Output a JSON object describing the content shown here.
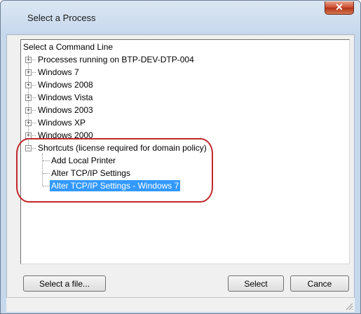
{
  "window": {
    "title": "Select a Process",
    "close_glyph": "✕"
  },
  "tree": {
    "header": "Select a Command Line",
    "expand_glyph": "+",
    "collapse_glyph": "−",
    "nodes": [
      "Processes running on BTP-DEV-DTP-004",
      "Windows 7",
      "Windows 2008",
      "Windows Vista",
      "Windows 2003",
      "Windows XP",
      "Windows 2000"
    ],
    "shortcuts": {
      "label": "Shortcuts (license required for domain policy)",
      "children": [
        "Add Local Printer",
        "Alter TCP/IP Settings",
        "Alter TCP/IP Settings - Windows 7"
      ],
      "selected_index": 2
    }
  },
  "buttons": {
    "select_file": "Select a file...",
    "select": "Select",
    "cancel": "Cance"
  },
  "colors": {
    "selection": "#3399ff",
    "annotation_oval": "#c0282d",
    "close_button": "#c9462d"
  }
}
